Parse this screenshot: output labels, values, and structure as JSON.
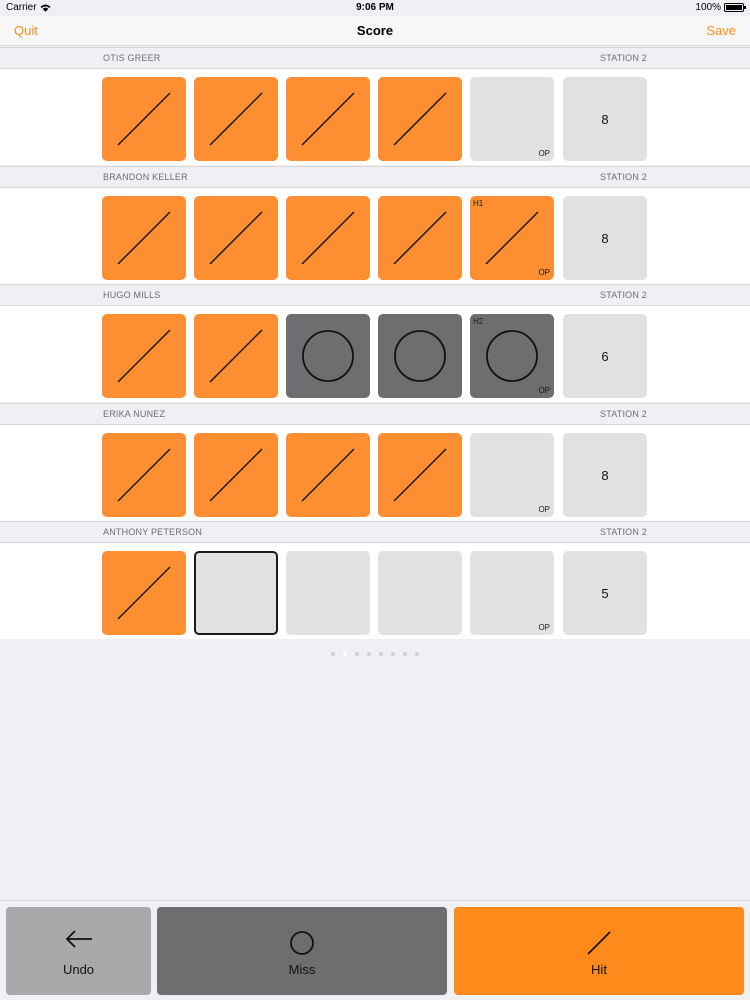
{
  "status": {
    "carrier": "Carrier",
    "time": "9:06 PM",
    "battery": "100%"
  },
  "nav": {
    "quit_label": "Quit",
    "title": "Score",
    "save_label": "Save"
  },
  "colors": {
    "accent": "#ff8c1a",
    "hit": "#fd8e32",
    "miss": "#6e6d70",
    "empty": "#e1e1e3"
  },
  "shooters": [
    {
      "name": "OTIS GREER",
      "station": "STATION 2",
      "total": "8",
      "cells": [
        {
          "state": "hit"
        },
        {
          "state": "hit"
        },
        {
          "state": "hit"
        },
        {
          "state": "hit"
        },
        {
          "state": "empty",
          "op": "OP"
        }
      ]
    },
    {
      "name": "BRANDON KELLER",
      "station": "STATION 2",
      "total": "8",
      "cells": [
        {
          "state": "hit"
        },
        {
          "state": "hit"
        },
        {
          "state": "hit"
        },
        {
          "state": "hit"
        },
        {
          "state": "hit",
          "op": "OP",
          "tag": "H1"
        }
      ]
    },
    {
      "name": "HUGO MILLS",
      "station": "STATION 2",
      "total": "6",
      "cells": [
        {
          "state": "hit"
        },
        {
          "state": "hit"
        },
        {
          "state": "miss"
        },
        {
          "state": "miss"
        },
        {
          "state": "miss",
          "op": "OP",
          "tag": "H2"
        }
      ]
    },
    {
      "name": "ERIKA NUNEZ",
      "station": "STATION 2",
      "total": "8",
      "cells": [
        {
          "state": "hit"
        },
        {
          "state": "hit"
        },
        {
          "state": "hit"
        },
        {
          "state": "hit"
        },
        {
          "state": "empty",
          "op": "OP"
        }
      ]
    },
    {
      "name": "ANTHONY PETERSON",
      "station": "STATION 2",
      "total": "5",
      "cells": [
        {
          "state": "hit"
        },
        {
          "state": "selected"
        },
        {
          "state": "empty"
        },
        {
          "state": "empty"
        },
        {
          "state": "empty",
          "op": "OP"
        }
      ]
    }
  ],
  "pager": {
    "count": 8,
    "active": 1
  },
  "actions": {
    "undo_label": "Undo",
    "miss_label": "Miss",
    "hit_label": "Hit"
  },
  "icons": {
    "undo": "left-arrow-icon",
    "miss": "circle-icon",
    "hit": "slash-icon"
  }
}
